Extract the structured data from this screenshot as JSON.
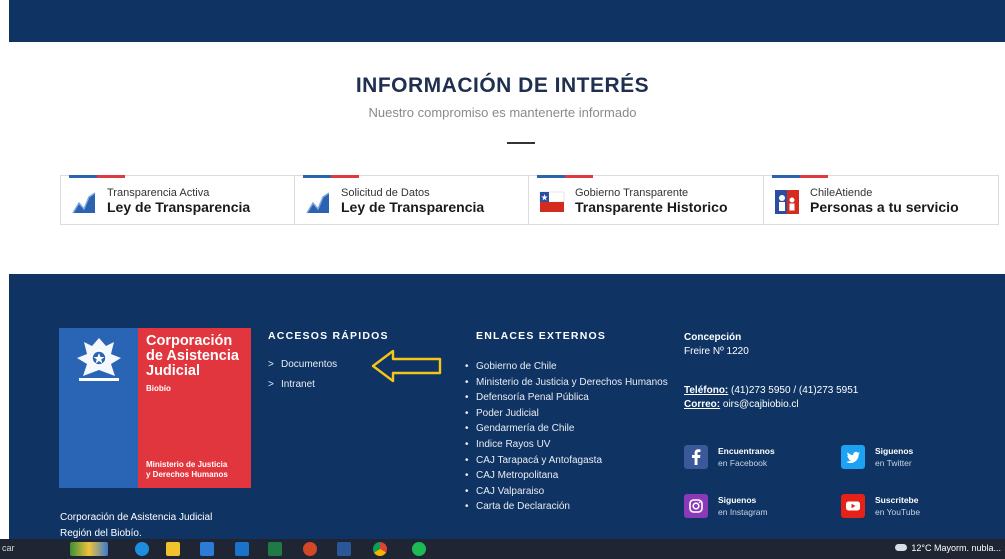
{
  "info": {
    "title": "INFORMACIÓN DE INTERÉS",
    "subtitle": "Nuestro compromiso es mantenerte informado"
  },
  "cards": [
    {
      "small": "Transparencia Activa",
      "big": "Ley de Transparencia"
    },
    {
      "small": "Solicitud de Datos",
      "big": "Ley de Transparencia"
    },
    {
      "small": "Gobierno Transparente",
      "big": "Transparente Historico"
    },
    {
      "small": "ChileAtiende",
      "big": "Personas a tu servicio"
    }
  ],
  "logo": {
    "title": "Corporación de Asistencia Judicial",
    "region": "Biobío",
    "ministry_1": "Ministerio de Justicia",
    "ministry_2": "y Derechos Humanos"
  },
  "quick_access": {
    "title": "ACCESOS RÁPIDOS",
    "chevron": ">",
    "items": [
      "Documentos",
      "Intranet"
    ]
  },
  "external_links": {
    "title": "ENLACES EXTERNOS",
    "items": [
      "Gobierno de Chile",
      "Ministerio de Justicia y Derechos Humanos",
      "Defensoría Penal Pública",
      "Poder Judicial",
      "Gendarmería de Chile",
      "Indice Rayos UV",
      "CAJ Tarapacá y Antofagasta",
      "CAJ Metropolitana",
      "CAJ Valparaiso",
      "Carta de Declaración"
    ]
  },
  "contact": {
    "city": "Concepción",
    "address": "Freire Nº 1220",
    "phone_label": "Teléfono:",
    "phone_value": " (41)273 5950 / (41)273 5951",
    "email_label": "Correo:",
    "email_value": " oirs@cajbiobio.cl"
  },
  "social": [
    {
      "line1": "Encuentranos",
      "line2": "en Facebook",
      "icon": "facebook-icon",
      "color": "#3b5998"
    },
    {
      "line1": "Siguenos",
      "line2": "en Twitter",
      "icon": "twitter-icon",
      "color": "#1da1f2"
    },
    {
      "line1": "Siguenos",
      "line2": "en Instagram",
      "icon": "instagram-icon",
      "color": "#8a3ab9"
    },
    {
      "line1": "Suscritebe",
      "line2": "en YouTube",
      "icon": "youtube-icon",
      "color": "#e62117"
    }
  ],
  "footer_org": {
    "line1": "Corporación de Asistencia Judicial",
    "line2": "Región del Biobío."
  },
  "taskbar": {
    "search_fragment": "car",
    "weather": "12°C  Mayorm. nubla..."
  },
  "colors": {
    "navy": "#0f3463",
    "blue": "#2a64b4",
    "red": "#e2363e",
    "arrow": "#f5c518"
  }
}
